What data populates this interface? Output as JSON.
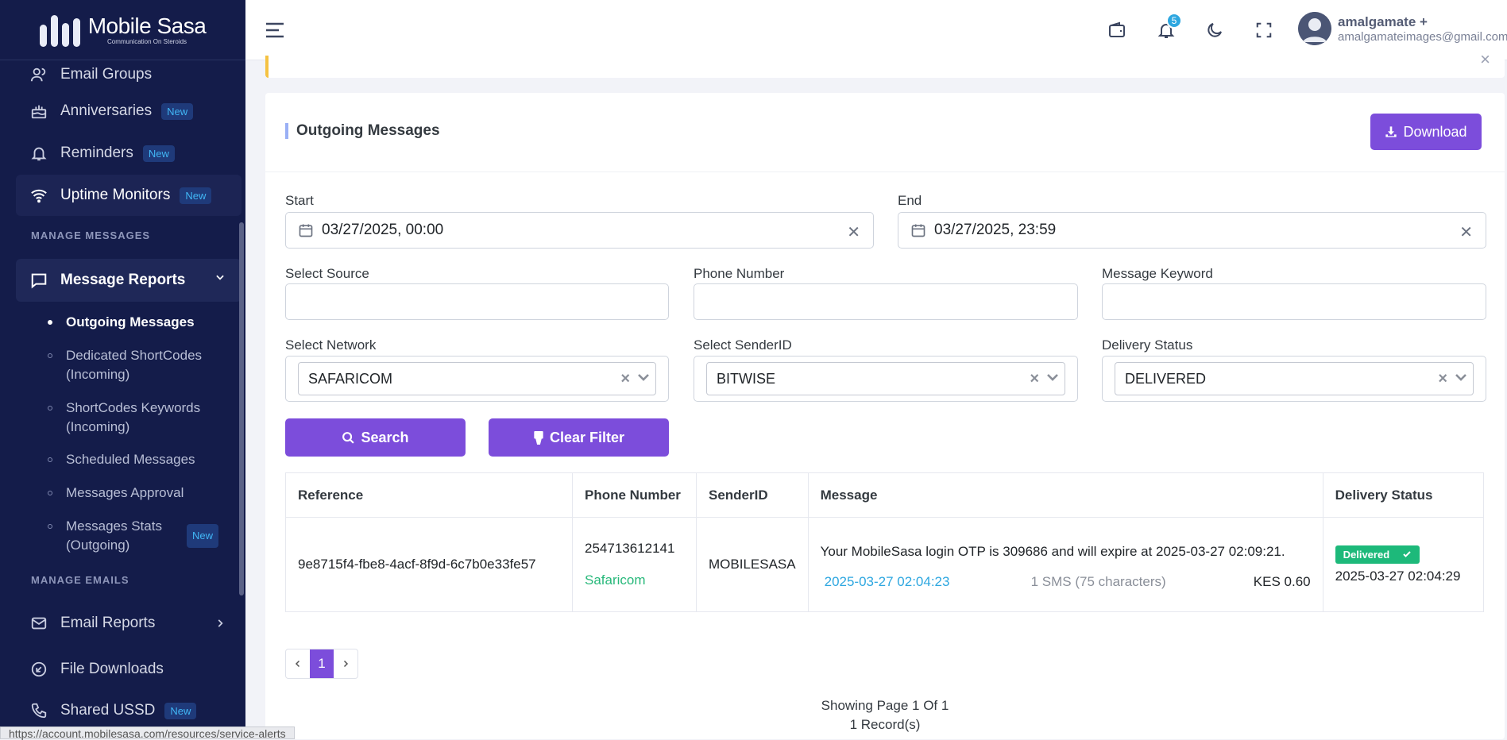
{
  "brand": {
    "name": "Mobile Sasa",
    "tagline": "Communication On Steroids"
  },
  "sidebar": {
    "items_top": [
      {
        "label": "Email Groups",
        "icon": "users-icon",
        "new": ""
      },
      {
        "label": "Anniversaries",
        "icon": "cake-icon",
        "new": "New"
      },
      {
        "label": "Reminders",
        "icon": "bell-icon",
        "new": "New"
      },
      {
        "label": "Uptime Monitors",
        "icon": "wifi-icon",
        "new": "New"
      }
    ],
    "section_messages": "MANAGE MESSAGES",
    "message_reports": "Message Reports",
    "sub_items": [
      {
        "label": "Outgoing Messages",
        "new": ""
      },
      {
        "label": "Dedicated ShortCodes (Incoming)",
        "new": ""
      },
      {
        "label": "ShortCodes Keywords (Incoming)",
        "new": ""
      },
      {
        "label": "Scheduled Messages",
        "new": ""
      },
      {
        "label": "Messages Approval",
        "new": ""
      },
      {
        "label": "Messages Stats (Outgoing)",
        "new": "New"
      }
    ],
    "section_emails": "MANAGE EMAILS",
    "items_bottom": [
      {
        "label": "Email Reports",
        "icon": "envelope-icon",
        "new": ""
      },
      {
        "label": "File Downloads",
        "icon": "download-circle-icon",
        "new": ""
      },
      {
        "label": "Shared USSD",
        "icon": "phone-icon",
        "new": "New"
      }
    ]
  },
  "topbar": {
    "notifications": "5",
    "user_name": "amalgamate +",
    "user_email": "amalgamateimages@gmail.com"
  },
  "card": {
    "title": "Outgoing Messages",
    "download_label": "Download"
  },
  "filters": {
    "start_label": "Start",
    "start_value": "03/27/2025, 00:00",
    "end_label": "End",
    "end_value": "03/27/2025, 23:59",
    "source_label": "Select Source",
    "source_value": "",
    "phone_label": "Phone Number",
    "phone_value": "",
    "keyword_label": "Message Keyword",
    "keyword_value": "",
    "network_label": "Select Network",
    "network_value": "SAFARICOM",
    "sender_label": "Select SenderID",
    "sender_value": "BITWISE",
    "status_label": "Delivery Status",
    "status_value": "DELIVERED",
    "search_label": "Search",
    "clear_label": "Clear Filter"
  },
  "table": {
    "headers": [
      "Reference",
      "Phone Number",
      "SenderID",
      "Message",
      "Delivery Status"
    ],
    "rows": [
      {
        "reference": "9e8715f4-fbe8-4acf-8f9d-6c7b0e33fe57",
        "phone": "254713612141",
        "network": "Safaricom",
        "sender": "MOBILESASA",
        "message": "Your MobileSasa login OTP is 309686 and will expire at 2025-03-27 02:09:21.",
        "sent_at": "2025-03-27 02:04:23",
        "sms_info": "1 SMS (75 characters)",
        "cost": "KES 0.60",
        "status": "Delivered",
        "delivered_at": "2025-03-27 02:04:29"
      }
    ]
  },
  "pagination": {
    "current_page": "1",
    "showing": "Showing Page 1 Of 1",
    "records": "1 Record(s)"
  },
  "status_url": "https://account.mobilesasa.com/resources/service-alerts"
}
